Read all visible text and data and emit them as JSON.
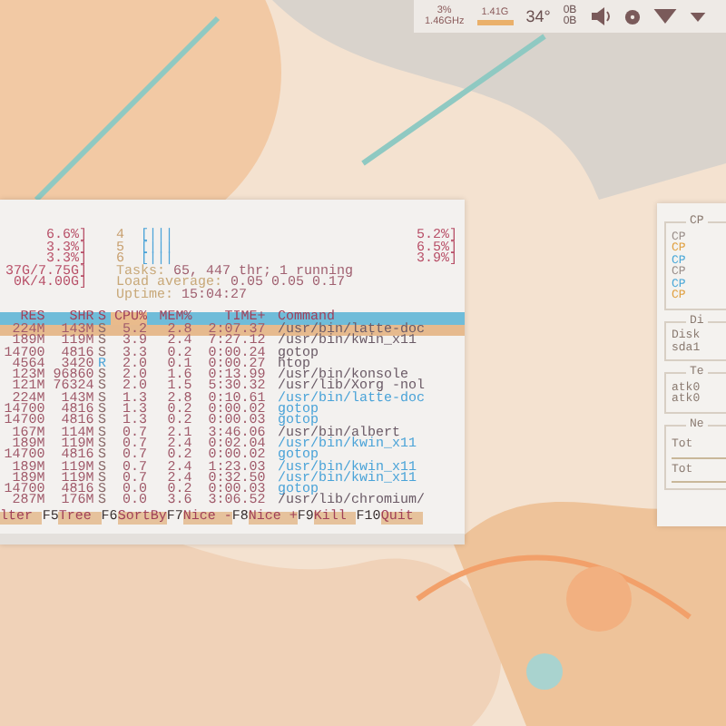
{
  "panel": {
    "cpu_percent": "3%",
    "cpu_frequency": "1.46GHz",
    "memory": {
      "text": "1.41G",
      "level": 1
    },
    "temperature": "34°",
    "network": [
      "0B",
      "0B"
    ]
  },
  "terminal": {
    "left_column": [
      "6.6%]",
      "3.3%]",
      "3.3%]",
      "37G/7.75G]",
      "0K/4.00G]"
    ],
    "cpu_meters": [
      {
        "label": "4",
        "bar": "[|||",
        "value": "5.2%]"
      },
      {
        "label": "5",
        "bar": "[|||",
        "value": "6.5%]"
      },
      {
        "label": "6",
        "bar": "[|||",
        "value": "3.9%]"
      }
    ],
    "info": [
      {
        "label": "Tasks:",
        "value": "65, 447 thr; 1 running"
      },
      {
        "label": "Load average:",
        "value": "0.05 0.05 0.17"
      },
      {
        "label": "Uptime:",
        "value": "15:04:27"
      }
    ],
    "columns": [
      {
        "label": "RES",
        "sorted": false
      },
      {
        "label": "SHR",
        "sorted": false
      },
      {
        "label": "S",
        "sorted": false
      },
      {
        "label": "CPU%",
        "sorted": true
      },
      {
        "label": "MEM%",
        "sorted": false
      },
      {
        "label": "TIME+",
        "sorted": false
      },
      {
        "label": "Command",
        "sorted": false
      }
    ],
    "processes": [
      {
        "res": "224M",
        "shr": "143M",
        "state": "S",
        "running": false,
        "cpu": "5.2",
        "mem": "2.8",
        "time": "2:07.37",
        "command": "/usr/bin/latte-doc",
        "kind": "process",
        "selected": true
      },
      {
        "res": "189M",
        "shr": "119M",
        "state": "S",
        "running": false,
        "cpu": "3.9",
        "mem": "2.4",
        "time": "7:27.12",
        "command": "/usr/bin/kwin_x11",
        "kind": "process",
        "selected": false
      },
      {
        "res": "14700",
        "shr": "4816",
        "state": "S",
        "running": false,
        "cpu": "3.3",
        "mem": "0.2",
        "time": "0:00.24",
        "command": "gotop",
        "kind": "process",
        "selected": false
      },
      {
        "res": "4564",
        "shr": "3420",
        "state": "R",
        "running": true,
        "cpu": "2.0",
        "mem": "0.1",
        "time": "0:00.27",
        "command": "htop",
        "kind": "process",
        "selected": false
      },
      {
        "res": "123M",
        "shr": "96860",
        "state": "S",
        "running": false,
        "cpu": "2.0",
        "mem": "1.6",
        "time": "0:13.99",
        "command": "/usr/bin/konsole",
        "kind": "process",
        "selected": false
      },
      {
        "res": "121M",
        "shr": "76324",
        "state": "S",
        "running": false,
        "cpu": "2.0",
        "mem": "1.5",
        "time": "5:30.32",
        "command": "/usr/lib/Xorg -nol",
        "kind": "process",
        "selected": false
      },
      {
        "res": "224M",
        "shr": "143M",
        "state": "S",
        "running": false,
        "cpu": "1.3",
        "mem": "2.8",
        "time": "0:10.61",
        "command": "/usr/bin/latte-doc",
        "kind": "thread",
        "selected": false
      },
      {
        "res": "14700",
        "shr": "4816",
        "state": "S",
        "running": false,
        "cpu": "1.3",
        "mem": "0.2",
        "time": "0:00.02",
        "command": "gotop",
        "kind": "thread",
        "selected": false
      },
      {
        "res": "14700",
        "shr": "4816",
        "state": "S",
        "running": false,
        "cpu": "1.3",
        "mem": "0.2",
        "time": "0:00.03",
        "command": "gotop",
        "kind": "thread",
        "selected": false
      },
      {
        "res": "167M",
        "shr": "114M",
        "state": "S",
        "running": false,
        "cpu": "0.7",
        "mem": "2.1",
        "time": "3:46.06",
        "command": "/usr/bin/albert",
        "kind": "process",
        "selected": false
      },
      {
        "res": "189M",
        "shr": "119M",
        "state": "S",
        "running": false,
        "cpu": "0.7",
        "mem": "2.4",
        "time": "0:02.04",
        "command": "/usr/bin/kwin_x11",
        "kind": "thread",
        "selected": false
      },
      {
        "res": "14700",
        "shr": "4816",
        "state": "S",
        "running": false,
        "cpu": "0.7",
        "mem": "0.2",
        "time": "0:00.02",
        "command": "gotop",
        "kind": "thread",
        "selected": false
      },
      {
        "res": "189M",
        "shr": "119M",
        "state": "S",
        "running": false,
        "cpu": "0.7",
        "mem": "2.4",
        "time": "1:23.03",
        "command": "/usr/bin/kwin_x11",
        "kind": "thread",
        "selected": false
      },
      {
        "res": "189M",
        "shr": "119M",
        "state": "S",
        "running": false,
        "cpu": "0.7",
        "mem": "2.4",
        "time": "0:32.50",
        "command": "/usr/bin/kwin_x11",
        "kind": "thread",
        "selected": false
      },
      {
        "res": "14700",
        "shr": "4816",
        "state": "S",
        "running": false,
        "cpu": "0.0",
        "mem": "0.2",
        "time": "0:00.03",
        "command": "gotop",
        "kind": "thread",
        "selected": false
      },
      {
        "res": "287M",
        "shr": "176M",
        "state": "S",
        "running": false,
        "cpu": "0.0",
        "mem": "3.6",
        "time": "3:06.52",
        "command": "/usr/lib/chromium/",
        "kind": "process",
        "selected": false
      }
    ],
    "function_keys": [
      {
        "label": "lter"
      },
      {
        "key": "F5",
        "label": "Tree"
      },
      {
        "key": "F6",
        "label": "SortBy"
      },
      {
        "key": "F7",
        "label": "Nice -"
      },
      {
        "key": "F8",
        "label": "Nice +"
      },
      {
        "key": "F9",
        "label": "Kill"
      },
      {
        "key": "F10",
        "label": "Quit"
      }
    ]
  },
  "monitor": {
    "groups": [
      {
        "legend": "CP",
        "lines": [
          {
            "text": "CP",
            "color": "#9a8f8a"
          },
          {
            "text": "CP",
            "color": "#e0a040"
          },
          {
            "text": "CP",
            "color": "#4aa8d8"
          },
          {
            "text": "CP",
            "color": "#9a8f8a"
          },
          {
            "text": "CP",
            "color": "#4aa8d8"
          },
          {
            "text": "CP",
            "color": "#e0a040"
          }
        ]
      },
      {
        "legend": "Di",
        "lines": [
          {
            "text": "Disk"
          },
          {
            "text": "sda1"
          }
        ]
      },
      {
        "legend": "Te",
        "lines": [
          {
            "text": "atk0"
          },
          {
            "text": "atk0"
          }
        ]
      },
      {
        "legend": "Ne",
        "lines": [
          {
            "text": "Tot"
          },
          {
            "text": "Tot"
          }
        ]
      }
    ]
  }
}
